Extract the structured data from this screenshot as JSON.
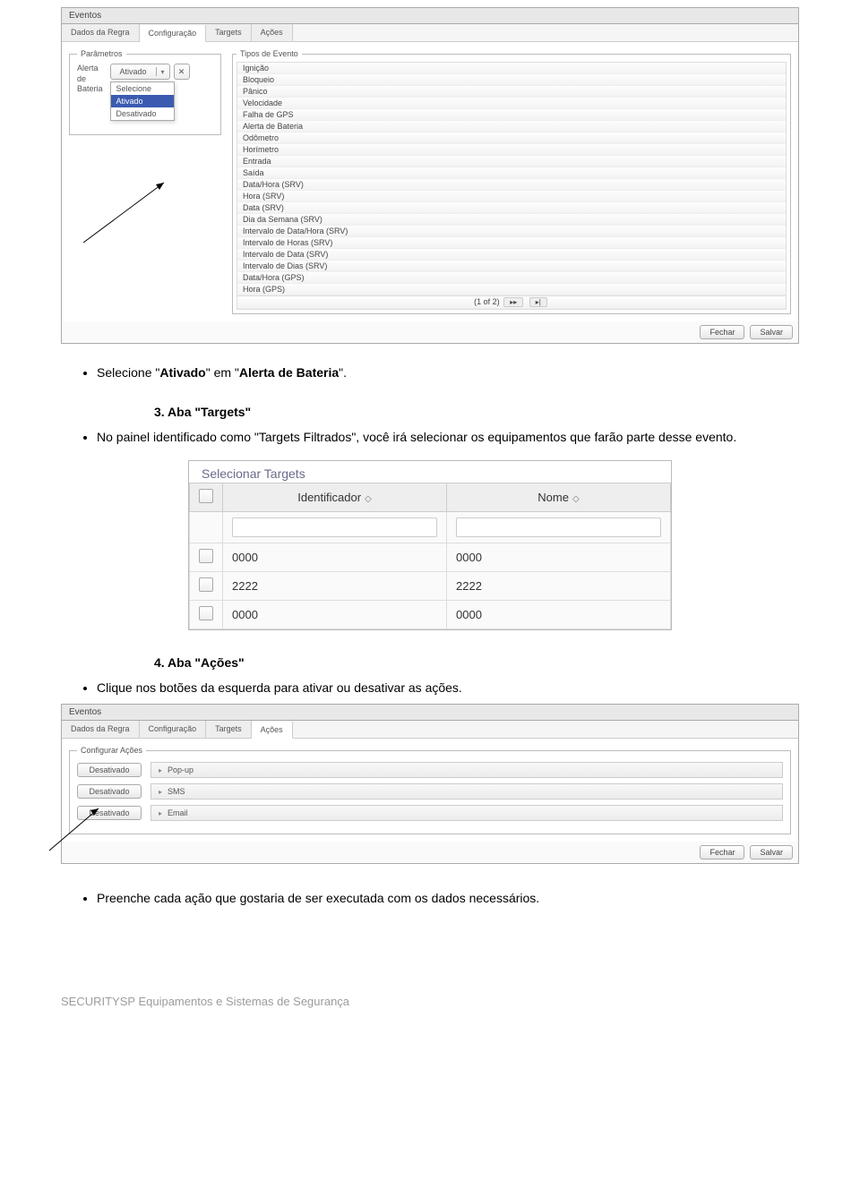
{
  "screenshot1": {
    "title": "Eventos",
    "tabs": [
      "Dados da Regra",
      "Configuração",
      "Targets",
      "Ações"
    ],
    "active_tab": 1,
    "params_legend": "Parâmetros",
    "param_label_line1": "Alerta",
    "param_label_line2": "de",
    "param_label_line3": "Bateria",
    "dd_selected": "Ativado",
    "dd_options": [
      "Selecione",
      "Ativado",
      "Desativado"
    ],
    "dd_highlight": 1,
    "x_btn": "✕",
    "events_legend": "Tipos de Evento",
    "events": [
      "Ignição",
      "Bloqueio",
      "Pânico",
      "Velocidade",
      "Falha de GPS",
      "Alerta de Bateria",
      "Odômetro",
      "Horímetro",
      "Entrada",
      "Saída",
      "Data/Hora (SRV)",
      "Hora (SRV)",
      "Data (SRV)",
      "Dia da Semana (SRV)",
      "Intervalo de Data/Hora (SRV)",
      "Intervalo de Horas (SRV)",
      "Intervalo de Data (SRV)",
      "Intervalo de Dias (SRV)",
      "Data/Hora (GPS)",
      "Hora (GPS)"
    ],
    "pager_text": "(1 of 2)",
    "pager_next": "▸▸",
    "pager_last": "▸|",
    "btn_close": "Fechar",
    "btn_save": "Salvar"
  },
  "doc": {
    "bullet1_prefix": "Selecione \"",
    "bullet1_bold": "Ativado",
    "bullet1_mid": "\" em \"",
    "bullet1_bold2": "Alerta de Bateria",
    "bullet1_suffix": "\".",
    "h3_num": "3. ",
    "h3_text": "Aba \"Targets\"",
    "bullet2": "No painel identificado como \"Targets Filtrados\", você irá selecionar os equipamentos que farão parte desse evento.",
    "h4_num": "4. ",
    "h4_text": "Aba \"Ações\"",
    "bullet3": "Clique nos botões da esquerda para ativar ou desativar as ações.",
    "bullet4": "Preenche cada ação que gostaria de ser executada com os dados necessários."
  },
  "screenshot2": {
    "legend": "Selecionar Targets",
    "col1": "Identificador",
    "col2": "Nome",
    "rows": [
      {
        "id": "0000",
        "name": "0000"
      },
      {
        "id": "2222",
        "name": "2222"
      },
      {
        "id": "0000",
        "name": "0000"
      }
    ]
  },
  "screenshot3": {
    "title": "Eventos",
    "tabs": [
      "Dados da Regra",
      "Configuração",
      "Targets",
      "Ações"
    ],
    "active_tab": 3,
    "legend": "Configurar Ações",
    "rows": [
      {
        "state": "Desativado",
        "label": "Pop-up"
      },
      {
        "state": "Desativado",
        "label": "SMS"
      },
      {
        "state": "Desativado",
        "label": "Email"
      }
    ],
    "btn_close": "Fechar",
    "btn_save": "Salvar"
  },
  "footer": "SECURITYSP  Equipamentos e Sistemas de Segurança"
}
